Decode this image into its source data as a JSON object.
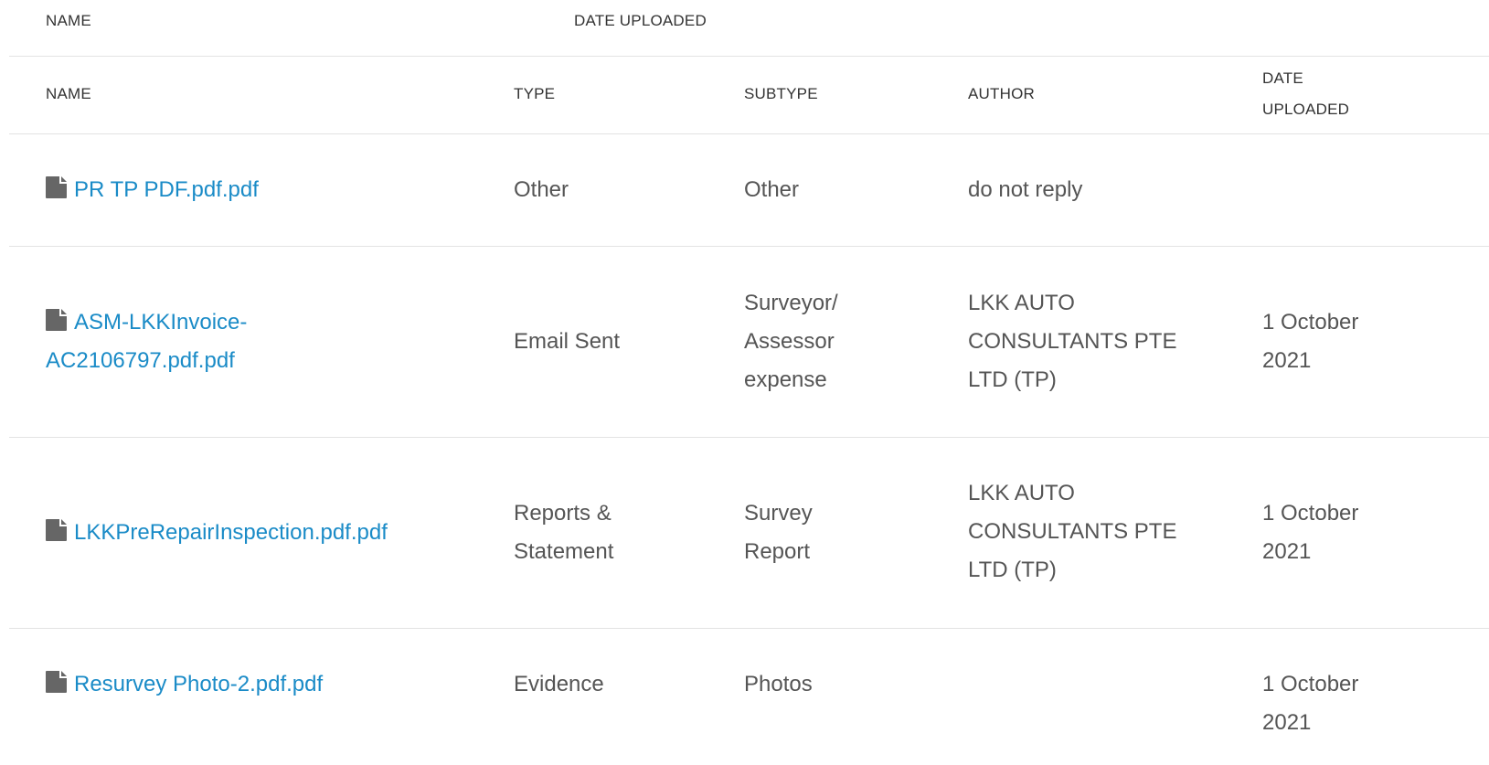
{
  "sort_header": {
    "name": "NAME",
    "date_uploaded": "DATE UPLOADED"
  },
  "table": {
    "columns": {
      "name": "NAME",
      "type": "TYPE",
      "subtype": "SUBTYPE",
      "author": "AUTHOR",
      "date_uploaded_line1": "DATE",
      "date_uploaded_line2": "UPLOADED"
    },
    "rows": [
      {
        "icon": "file-icon",
        "name_lines": [
          "PR TP PDF.pdf.pdf"
        ],
        "type_lines": [
          "Other"
        ],
        "subtype_lines": [
          "Other"
        ],
        "author_lines": [
          "do not reply"
        ],
        "date_lines": []
      },
      {
        "icon": "file-icon",
        "name_lines": [
          "ASM-LKKInvoice-",
          "AC2106797.pdf.pdf"
        ],
        "type_lines": [
          "Email Sent"
        ],
        "subtype_lines": [
          "Surveyor/",
          "Assessor",
          "expense"
        ],
        "author_lines": [
          "LKK AUTO",
          "CONSULTANTS PTE",
          "LTD (TP)"
        ],
        "date_lines": [
          "1 October",
          "2021"
        ]
      },
      {
        "icon": "file-icon",
        "name_lines": [
          "LKKPreRepairInspection.pdf.pdf"
        ],
        "type_lines": [
          "Reports &",
          "Statement"
        ],
        "subtype_lines": [
          "Survey",
          "Report"
        ],
        "author_lines": [
          "LKK AUTO",
          "CONSULTANTS PTE",
          "LTD (TP)"
        ],
        "date_lines": [
          "1 October",
          "2021"
        ]
      },
      {
        "icon": "file-icon",
        "name_lines": [
          "Resurvey Photo-2.pdf.pdf"
        ],
        "type_lines": [
          "Evidence"
        ],
        "subtype_lines": [
          "Photos"
        ],
        "author_lines": [],
        "date_lines": [
          "1 October",
          "2021"
        ]
      }
    ]
  },
  "colors": {
    "link": "#1a8bc7",
    "text": "#555555",
    "header": "#333333",
    "rule": "#e3e3e3",
    "icon": "#666666"
  }
}
